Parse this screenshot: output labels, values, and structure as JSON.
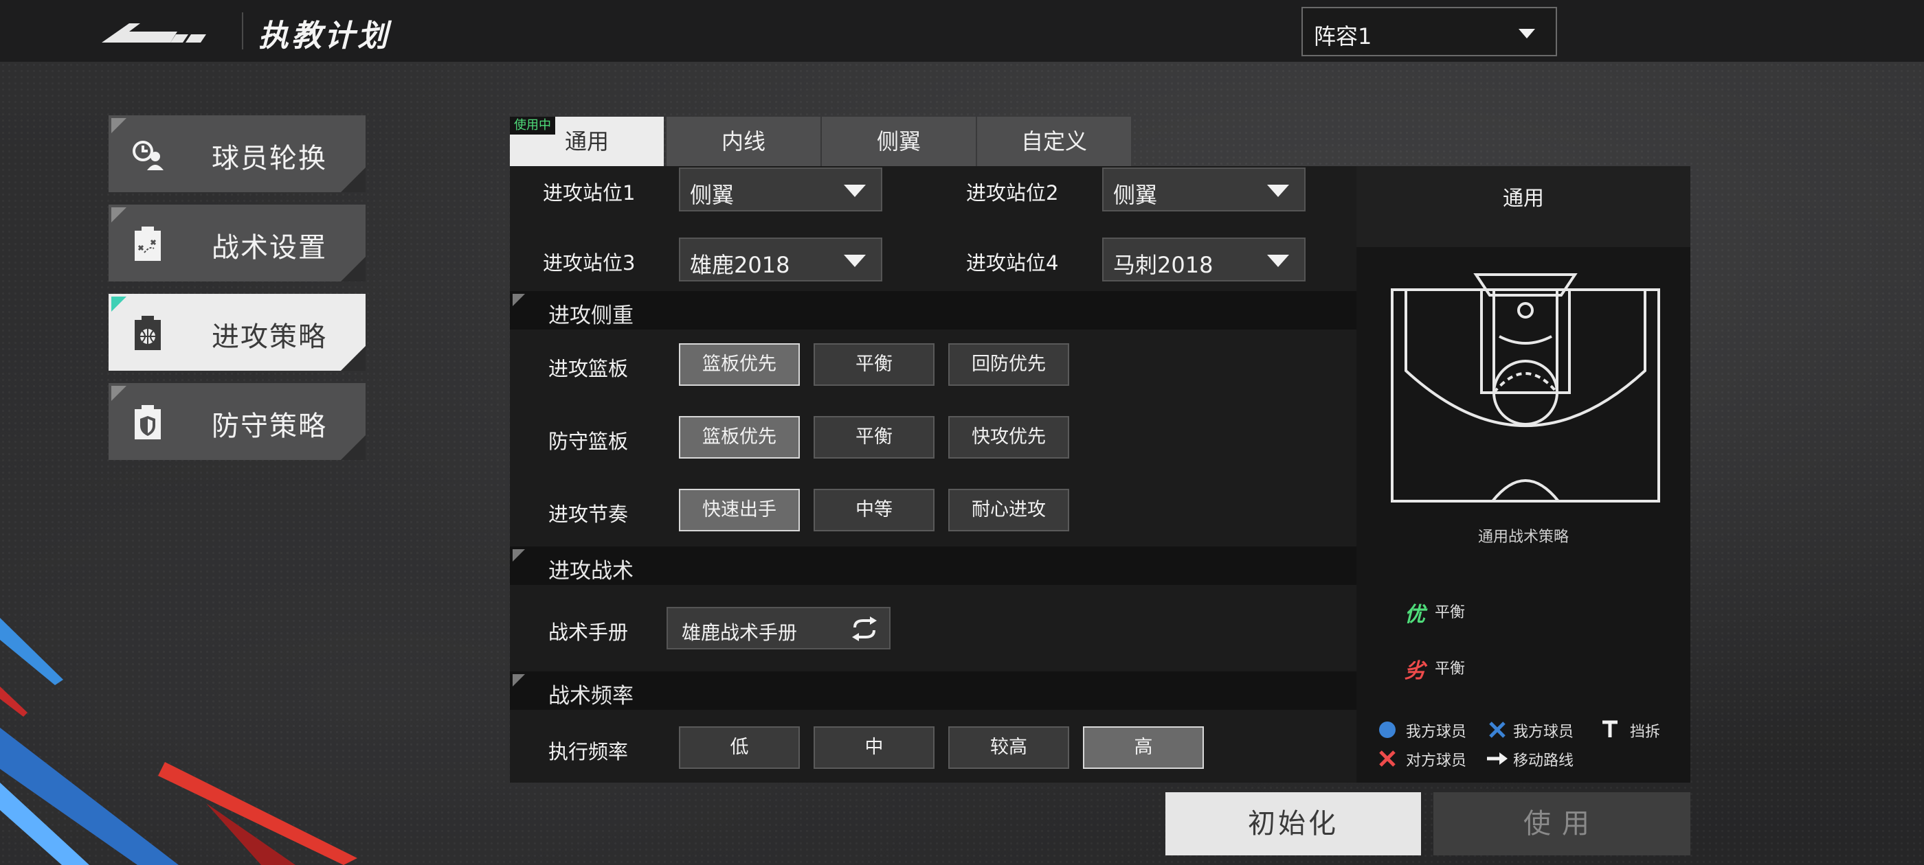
{
  "header": {
    "title": "执教计划",
    "lineup_value": "阵容1"
  },
  "sidebar": {
    "items": [
      {
        "label": "球员轮换",
        "icon": "player-rotation-icon"
      },
      {
        "label": "战术设置",
        "icon": "tactics-board-icon"
      },
      {
        "label": "进攻策略",
        "icon": "basketball-clipboard-icon",
        "active": true
      },
      {
        "label": "防守策略",
        "icon": "shield-clipboard-icon"
      }
    ]
  },
  "tabs": {
    "in_use_badge": "使用中",
    "items": [
      {
        "label": "通用",
        "active": true
      },
      {
        "label": "内线"
      },
      {
        "label": "侧翼"
      },
      {
        "label": "自定义"
      }
    ]
  },
  "positions": [
    {
      "label": "进攻站位1",
      "value": "侧翼"
    },
    {
      "label": "进攻站位2",
      "value": "侧翼"
    },
    {
      "label": "进攻站位3",
      "value": "雄鹿2018"
    },
    {
      "label": "进攻站位4",
      "value": "马刺2018"
    }
  ],
  "sections": {
    "focus": {
      "title": "进攻侧重",
      "rows": [
        {
          "label": "进攻篮板",
          "options": [
            "篮板优先",
            "平衡",
            "回防优先"
          ],
          "selected": 0
        },
        {
          "label": "防守篮板",
          "options": [
            "篮板优先",
            "平衡",
            "快攻优先"
          ],
          "selected": 0
        },
        {
          "label": "进攻节奏",
          "options": [
            "快速出手",
            "中等",
            "耐心进攻"
          ],
          "selected": 0
        }
      ]
    },
    "tactics": {
      "title": "进攻战术",
      "playbook_label": "战术手册",
      "playbook_value": "雄鹿战术手册"
    },
    "frequency": {
      "title": "战术频率",
      "row_label": "执行频率",
      "options": [
        "低",
        "中",
        "较高",
        "高"
      ],
      "selected": 3
    }
  },
  "preview": {
    "title": "通用",
    "caption": "通用战术策略",
    "strength_mark": "优",
    "strength_text": "平衡",
    "weakness_mark": "劣",
    "weakness_text": "平衡",
    "legend": {
      "own_player": "我方球员",
      "own_player_x": "我方球员",
      "screen": "挡拆",
      "opponent": "对方球员",
      "move_route": "移动路线"
    }
  },
  "actions": {
    "reset": "初始化",
    "apply": "使用"
  },
  "colors": {
    "accent_green": "#4fdc7a",
    "accent_red": "#ef4b4b",
    "accent_teal": "#3fd0b5",
    "legend_blue": "#3b83d6"
  }
}
